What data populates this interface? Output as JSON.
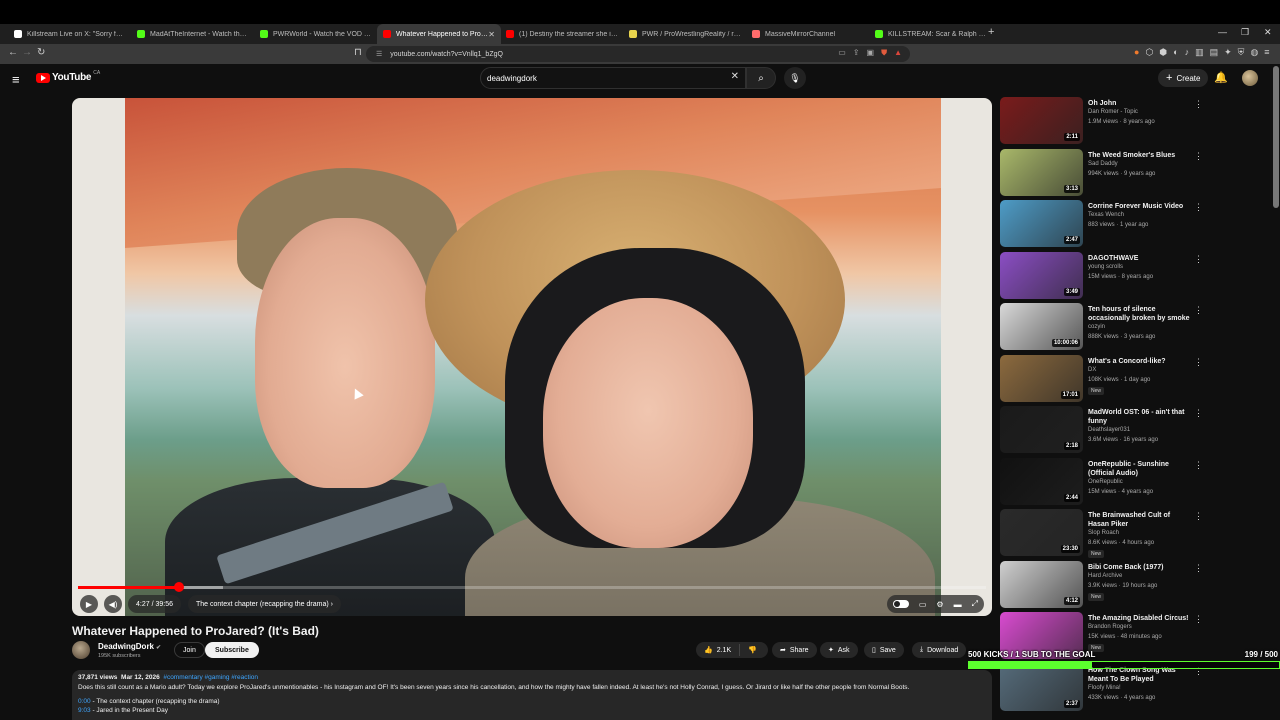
{
  "browser": {
    "tabs": [
      {
        "label": "Killstream Live on X: \"Sorry for what I",
        "fav": "#ffffff",
        "active": false
      },
      {
        "label": "MadAtTheInternet - Watch the VOD",
        "fav": "#53fc18",
        "active": false
      },
      {
        "label": "PWRWorld - Watch the VOD on Kick",
        "fav": "#53fc18",
        "active": false
      },
      {
        "label": "Whatever Happened to ProJared",
        "fav": "#ff0000",
        "active": true
      },
      {
        "label": "(1) Destiny the streamer she is coming",
        "fav": "#ff0000",
        "active": false
      },
      {
        "label": "PWR / ProWrestlingReality / realpwr",
        "fav": "#e8d44d",
        "active": false
      },
      {
        "label": "MassiveMirrorChannel",
        "fav": "#ff6b6b",
        "active": false
      },
      {
        "label": "KILLSTREAM: Scar & Ralph Friday Fire",
        "fav": "#53fc18",
        "active": false
      }
    ],
    "url": "youtube.com/watch?v=Vnllq1_bZgQ"
  },
  "header": {
    "logo_text": "YouTube",
    "region": "CA",
    "search_value": "deadwingdork",
    "create_label": "Create"
  },
  "player": {
    "time": "4:27 / 39:56",
    "chapter": "The context chapter (recapping the drama)",
    "progress_fraction": 0.111,
    "buffer_fraction": 0.16
  },
  "video": {
    "title": "Whatever Happened to ProJared? (It's Bad)",
    "channel": "DeadwingDork",
    "subscribers": "195K subscribers",
    "join_label": "Join",
    "subscribe_label": "Subscribe",
    "likes": "2.1K",
    "share_label": "Share",
    "ask_label": "Ask",
    "save_label": "Save",
    "download_label": "Download"
  },
  "description": {
    "views": "37,871 views",
    "date": "Mar 12, 2026",
    "tags": "#commentary #gaming #reaction",
    "text": "Does this still count as a Mario adult? Today we explore ProJared's unmentionables - his Instagram and OF! It's been seven years since his cancellation, and how the mighty have fallen indeed. At least he's not Holly Conrad, I guess. Or Jirard or like half the other people from Normal Boots.",
    "chapters": [
      {
        "ts": "0:00",
        "label": " - The context chapter (recapping the drama)"
      },
      {
        "ts": "9:03",
        "label": " - Jared in the Present Day"
      }
    ]
  },
  "recommendations": [
    {
      "title": "Oh John",
      "channel": "Dan Romer - Topic",
      "meta": "1.9M views · 8 years ago",
      "duration": "2:11",
      "new": "",
      "thumb": "#7a1b1b"
    },
    {
      "title": "The Weed Smoker's Blues",
      "channel": "Sad Daddy",
      "meta": "994K views · 9 years ago",
      "duration": "3:13",
      "new": "",
      "thumb": "#a9b86a"
    },
    {
      "title": "Corrine Forever Music Video",
      "channel": "Texas Wench",
      "meta": "883 views · 1 year ago",
      "duration": "2:47",
      "new": "",
      "thumb": "#4e9cc7"
    },
    {
      "title": "DAGOTHWAVE",
      "channel": "young scrolls",
      "meta": "15M views · 8 years ago",
      "duration": "3:49",
      "new": "",
      "thumb": "#8b4ec4"
    },
    {
      "title": "Ten hours of silence occasionally broken by smoke ...",
      "channel": "cozyin",
      "meta": "888K views · 3 years ago",
      "duration": "10:00:06",
      "new": "",
      "thumb": "#d9d9d9"
    },
    {
      "title": "What's a Concord-like?",
      "channel": "DX",
      "meta": "108K views · 1 day ago",
      "duration": "17:01",
      "new": "New",
      "thumb": "#8c6a3e"
    },
    {
      "title": "MadWorld OST: 06 - ain't that funny",
      "channel": "Deathslayer031",
      "meta": "3.6M views · 16 years ago",
      "duration": "2:18",
      "new": "",
      "thumb": "#1a1a1a"
    },
    {
      "title": "OneRepublic - Sunshine (Official Audio)",
      "channel": "OneRepublic",
      "meta": "15M views · 4 years ago",
      "duration": "2:44",
      "new": "",
      "thumb": "#111111"
    },
    {
      "title": "The Brainwashed Cult of Hasan Piker",
      "channel": "Slop Roach",
      "meta": "8.6K views · 4 hours ago",
      "duration": "23:30",
      "new": "New",
      "thumb": "#2a2a2a"
    },
    {
      "title": "Bibi Come Back (1977)",
      "channel": "Hard Archive",
      "meta": "3.9K views · 19 hours ago",
      "duration": "4:12",
      "new": "New",
      "thumb": "#cfcfcf"
    },
    {
      "title": "The Amazing Disabled Circus!",
      "channel": "Brandon Rogers",
      "meta": "15K views · 48 minutes ago",
      "duration": "",
      "new": "New",
      "thumb": "#d94bd0"
    },
    {
      "title": "How The Clown Song Was Meant To Be Played",
      "channel": "Floofy Mina!",
      "meta": "433K views · 4 years ago",
      "duration": "2:37",
      "new": "",
      "thumb": "#556b7a"
    }
  ],
  "goal": {
    "label": "500 KICKS / 1 SUB TO THE GOAL",
    "count": "199  / 500",
    "fraction": 0.398
  }
}
